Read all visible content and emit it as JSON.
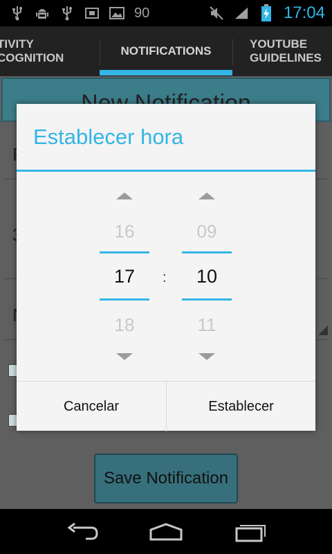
{
  "status_bar": {
    "icons_left": [
      "usb-icon",
      "android-debug-icon",
      "usb-icon",
      "screenshot-icon",
      "image-icon"
    ],
    "notification_count": "90",
    "icons_right": [
      "mute-icon",
      "signal-icon",
      "battery-charging-icon"
    ],
    "time": "17:04"
  },
  "tabs": {
    "items": [
      {
        "label": "TIVITY\nCOGNITION"
      },
      {
        "label": "NOTIFICATIONS",
        "selected": true
      },
      {
        "label": "YOUTUBE\nGUIDELINES"
      }
    ]
  },
  "background": {
    "banner_text": "New Notification",
    "field_letters": [
      "F",
      "3",
      "N"
    ],
    "save_button_label": "Save Notification"
  },
  "dialog": {
    "title": "Establecer hora",
    "hour": {
      "prev": "16",
      "current": "17",
      "next": "18"
    },
    "separator": ":",
    "minute": {
      "prev": "09",
      "current": "10",
      "next": "11"
    },
    "cancel_label": "Cancelar",
    "set_label": "Establecer"
  },
  "colors": {
    "accent": "#33b5e5",
    "status_text": "#9e9e9e",
    "dialog_bg": "#f4f4f4"
  },
  "nav_bar": {
    "buttons": [
      "back-icon",
      "home-icon",
      "recent-apps-icon"
    ]
  }
}
